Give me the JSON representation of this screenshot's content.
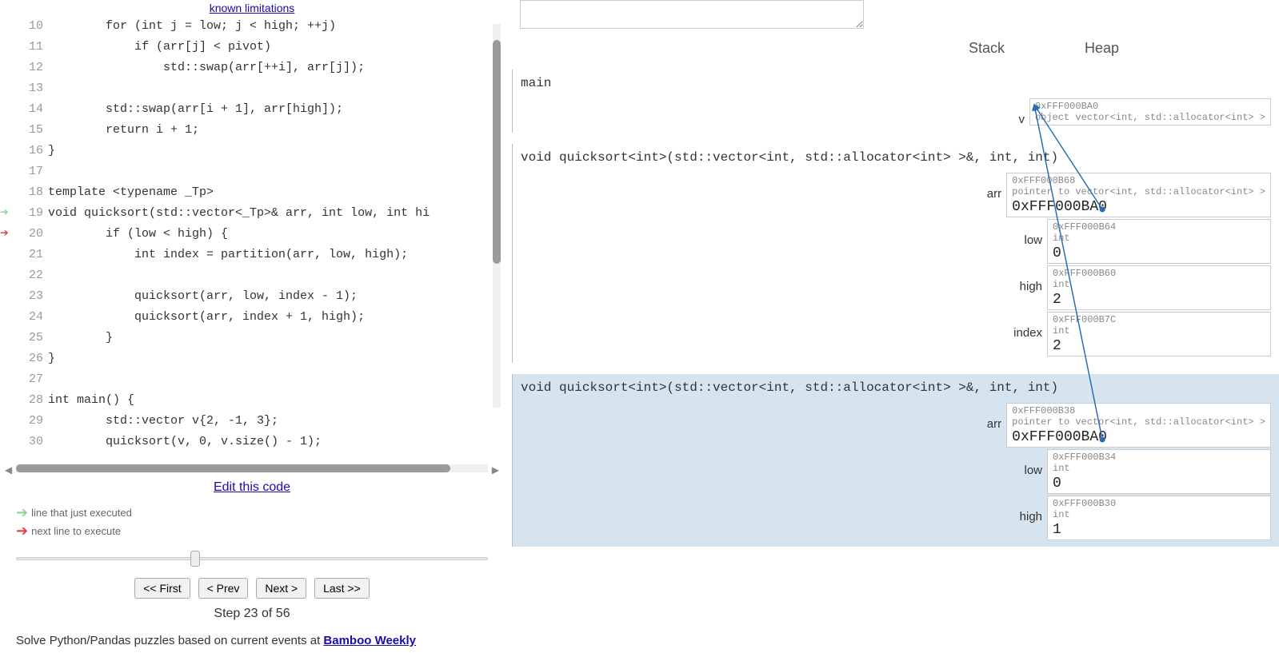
{
  "links": {
    "known_limitations": "known limitations",
    "edit_code": "Edit this code",
    "bamboo": "Bamboo Weekly"
  },
  "legend": {
    "just_executed": "line that just executed",
    "next_line": "next line to execute"
  },
  "nav": {
    "first": "<< First",
    "prev": "< Prev",
    "next": "Next >",
    "last": "Last >>"
  },
  "step": {
    "label": "Step 23 of 56",
    "current": 23,
    "total": 56
  },
  "promo": {
    "text_before": "Solve Python/Pandas puzzles based on current events at ",
    "link": "Bamboo Weekly"
  },
  "columns": {
    "stack": "Stack",
    "heap": "Heap"
  },
  "code": {
    "green_arrow_line": 19,
    "red_arrow_line": 20,
    "lines": [
      {
        "n": 10,
        "text": "        for (int j = low; j < high; ++j)"
      },
      {
        "n": 11,
        "text": "            if (arr[j] < pivot)"
      },
      {
        "n": 12,
        "text": "                std::swap(arr[++i], arr[j]);"
      },
      {
        "n": 13,
        "text": ""
      },
      {
        "n": 14,
        "text": "        std::swap(arr[i + 1], arr[high]);"
      },
      {
        "n": 15,
        "text": "        return i + 1;"
      },
      {
        "n": 16,
        "text": "}"
      },
      {
        "n": 17,
        "text": ""
      },
      {
        "n": 18,
        "text": "template <typename _Tp>"
      },
      {
        "n": 19,
        "text": "void quicksort(std::vector<_Tp>& arr, int low, int hi"
      },
      {
        "n": 20,
        "text": "        if (low < high) {"
      },
      {
        "n": 21,
        "text": "            int index = partition(arr, low, high);"
      },
      {
        "n": 22,
        "text": ""
      },
      {
        "n": 23,
        "text": "            quicksort(arr, low, index - 1);"
      },
      {
        "n": 24,
        "text": "            quicksort(arr, index + 1, high);"
      },
      {
        "n": 25,
        "text": "        }"
      },
      {
        "n": 26,
        "text": "}"
      },
      {
        "n": 27,
        "text": ""
      },
      {
        "n": 28,
        "text": "int main() {"
      },
      {
        "n": 29,
        "text": "        std::vector v{2, -1, 3};"
      },
      {
        "n": 30,
        "text": "        quicksort(v, 0, v.size() - 1);"
      }
    ]
  },
  "frames": [
    {
      "title": "main",
      "active": false,
      "vars": [
        {
          "name": "v",
          "addr": "0xFFF000BA0",
          "type": "object vector<int, std::allocator<int> >",
          "value": ""
        }
      ]
    },
    {
      "title": "void quicksort<int>(std::vector<int, std::allocator<int> >&, int, int)",
      "active": false,
      "vars": [
        {
          "name": "arr",
          "addr": "0xFFF000B68",
          "type": "pointer to vector<int, std::allocator<int> >",
          "value": "0xFFF000BA0"
        },
        {
          "name": "low",
          "addr": "0xFFF000B64",
          "type": "int",
          "value": "0"
        },
        {
          "name": "high",
          "addr": "0xFFF000B60",
          "type": "int",
          "value": "2"
        },
        {
          "name": "index",
          "addr": "0xFFF000B7C",
          "type": "int",
          "value": "2"
        }
      ]
    },
    {
      "title": "void quicksort<int>(std::vector<int, std::allocator<int> >&, int, int)",
      "active": true,
      "vars": [
        {
          "name": "arr",
          "addr": "0xFFF000B38",
          "type": "pointer to vector<int, std::allocator<int> >",
          "value": "0xFFF000BA0"
        },
        {
          "name": "low",
          "addr": "0xFFF000B34",
          "type": "int",
          "value": "0"
        },
        {
          "name": "high",
          "addr": "0xFFF000B30",
          "type": "int",
          "value": "1"
        }
      ]
    }
  ]
}
